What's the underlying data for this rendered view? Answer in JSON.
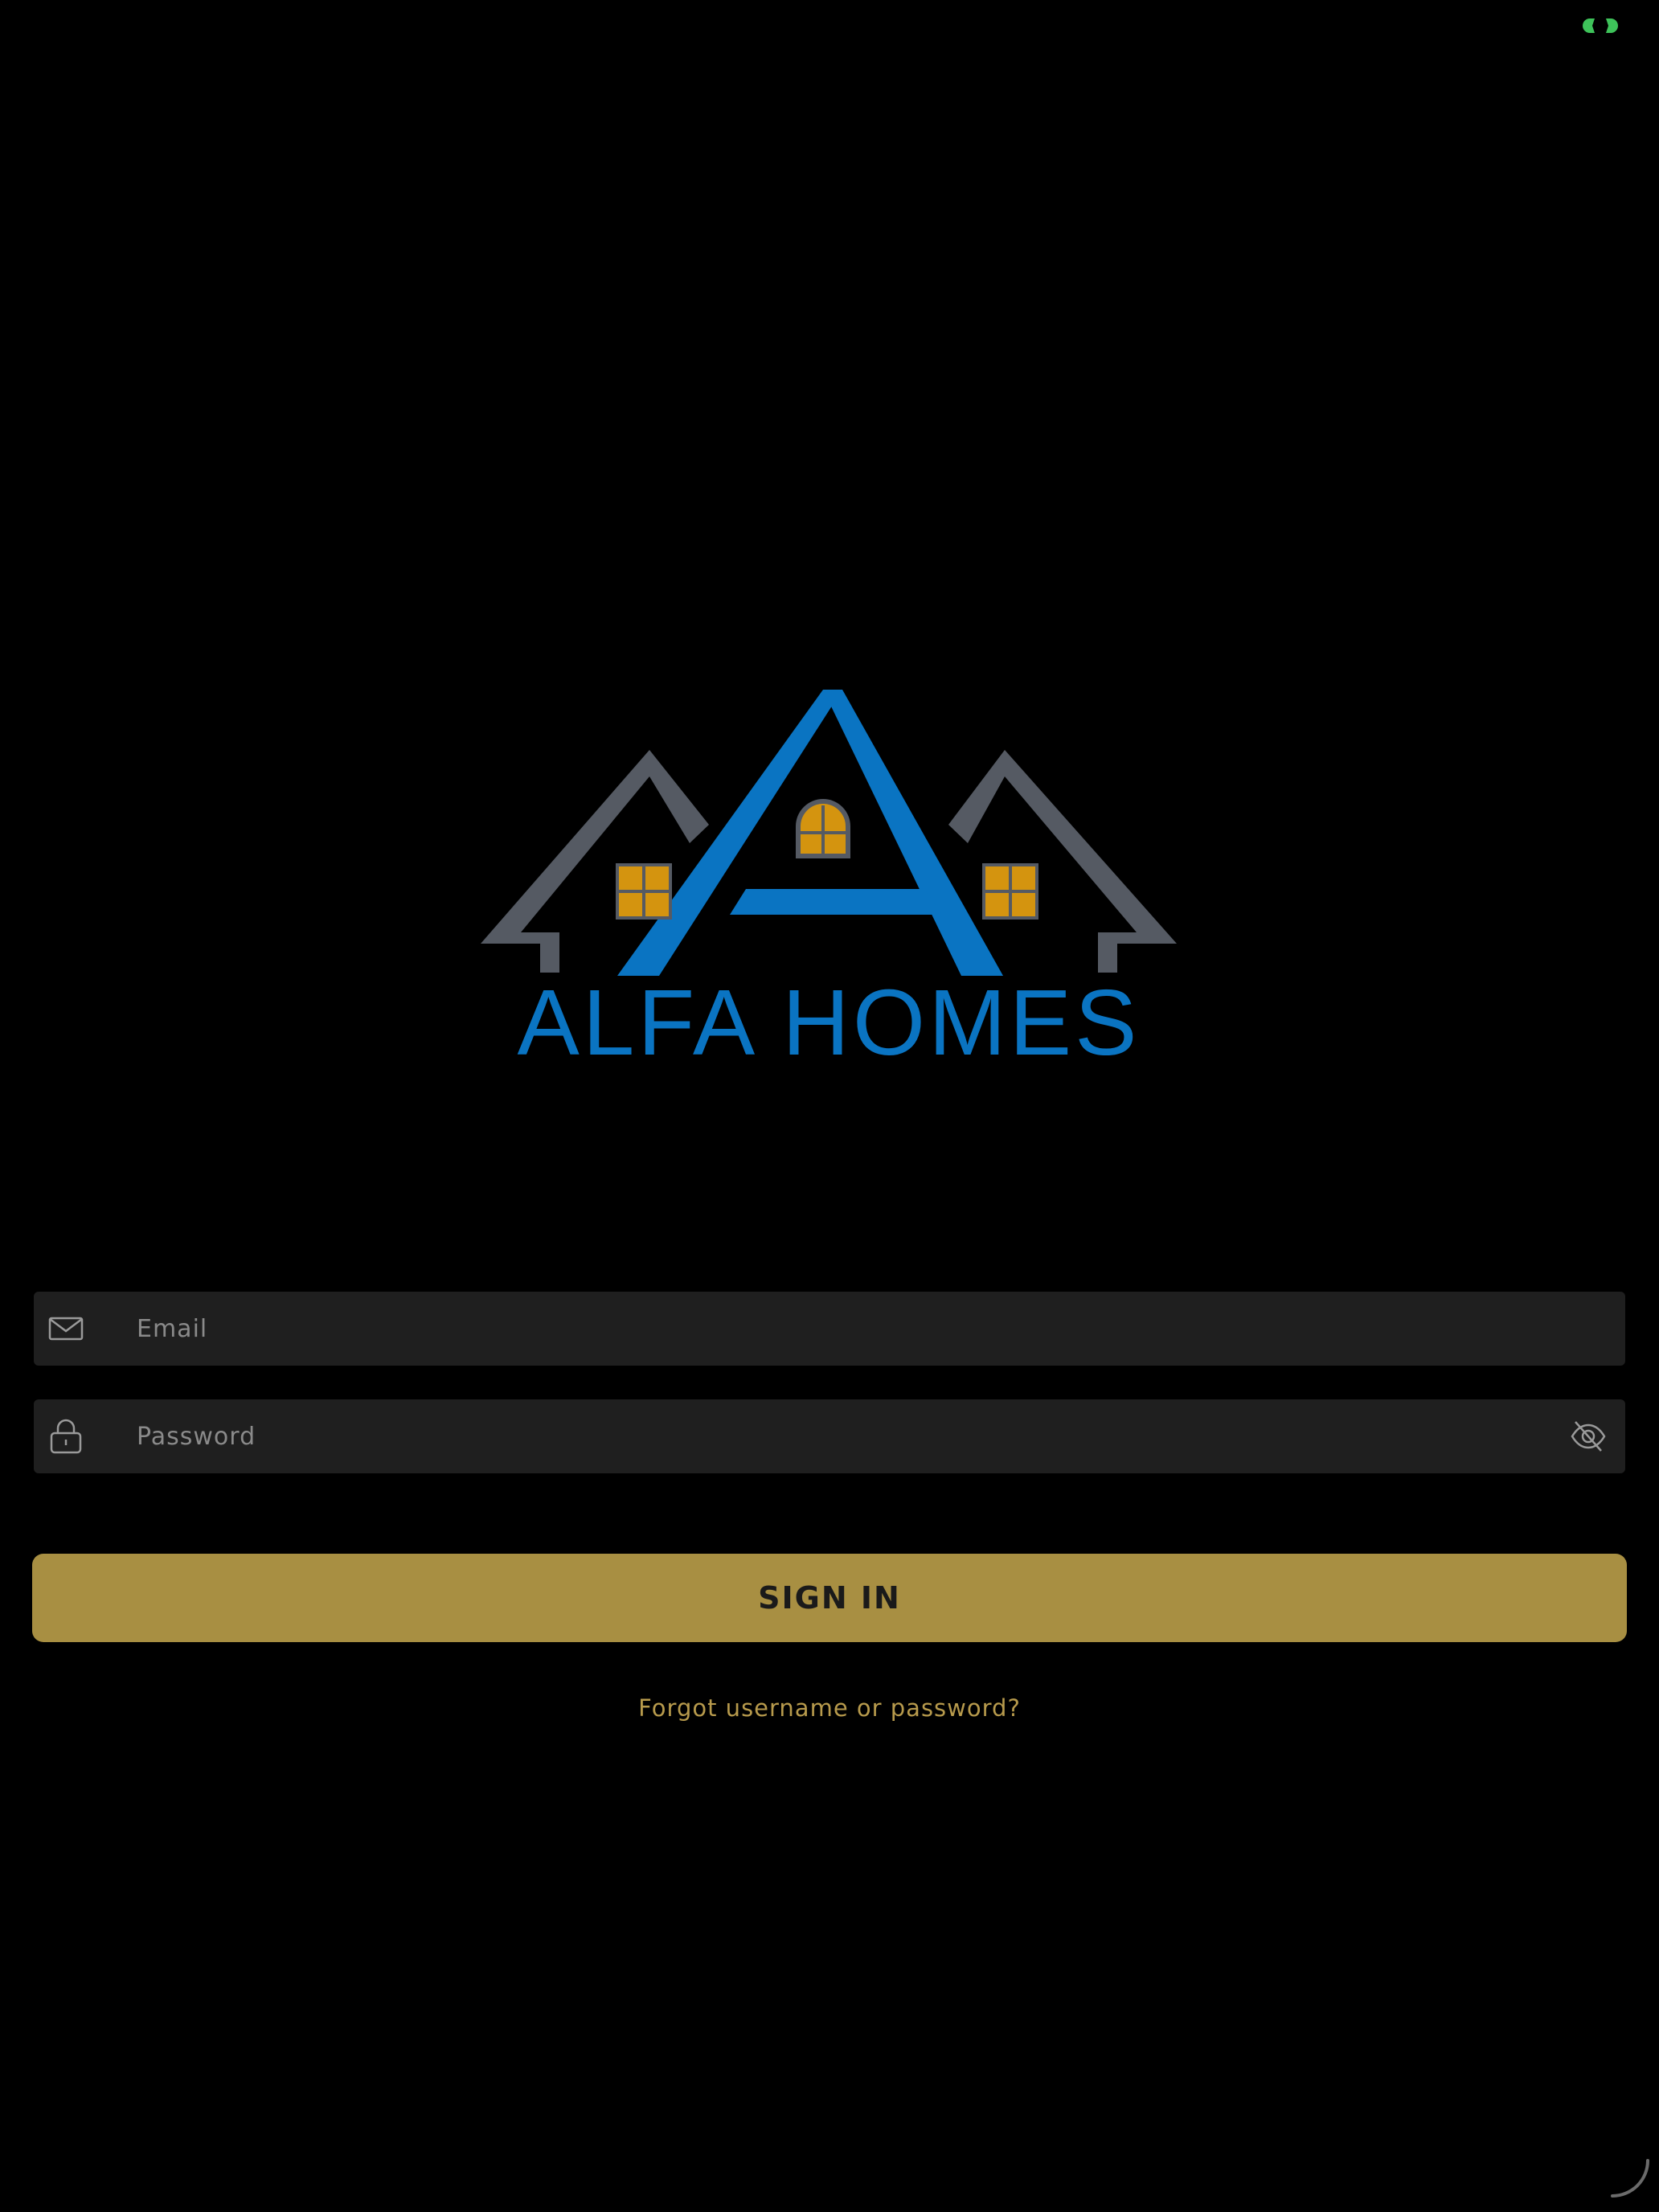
{
  "brand": {
    "name": "ALFA HOMES",
    "primary_color": "#0a74c2",
    "roof_color": "#555a63",
    "window_color": "#d4940f"
  },
  "login_form": {
    "email_placeholder": "Email",
    "email_value": "",
    "password_placeholder": "Password",
    "password_value": "",
    "submit_label": "SIGN IN",
    "forgot_link": "Forgot username or password?"
  },
  "icons": {
    "status": "camera-indicator-icon",
    "email": "mail-icon",
    "password": "lock-icon",
    "visibility": "eye-off-icon",
    "corner": "resize-handle-icon"
  },
  "colors": {
    "background": "#000000",
    "field_background": "#1f1f1f",
    "button": "#a88f42",
    "link": "#b79a4c",
    "status_indicator": "#3ec35a"
  }
}
